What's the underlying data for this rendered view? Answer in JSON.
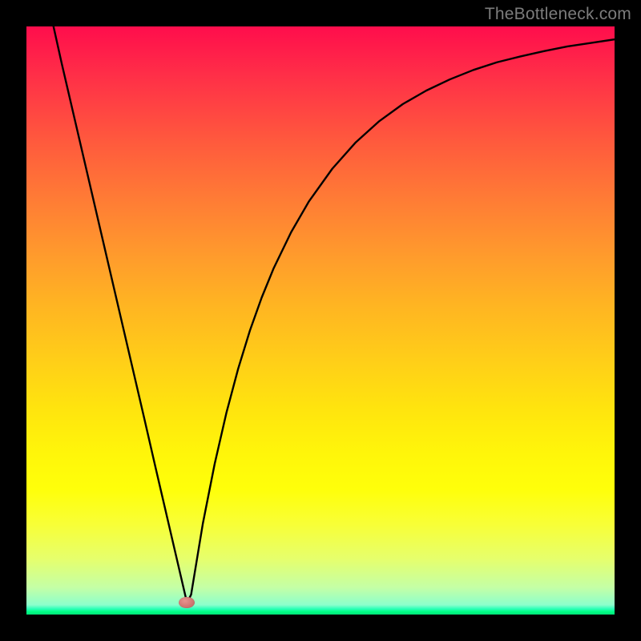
{
  "watermark": "TheBottleneck.com",
  "colors": {
    "frame": "#000000",
    "curve_stroke": "#000000",
    "marker_fill": "#d67c78",
    "gradient_top": "#ff0d4c",
    "gradient_mid": "#ffe40e",
    "gradient_bottom_green": "#03e27a"
  },
  "chart_data": {
    "type": "line",
    "title": "",
    "xlabel": "",
    "ylabel": "",
    "xlim": [
      0,
      100
    ],
    "ylim": [
      0,
      100
    ],
    "series": [
      {
        "name": "bottleneck-curve",
        "x": [
          4.6,
          6,
          8,
          10,
          12,
          14,
          16,
          18,
          20,
          22,
          24,
          26,
          27.3,
          28,
          30,
          32,
          34,
          36,
          38,
          40,
          42,
          45,
          48,
          52,
          56,
          60,
          64,
          68,
          72,
          76,
          80,
          84,
          88,
          92,
          96,
          100
        ],
        "y": [
          100,
          93.7,
          85.1,
          76.5,
          67.9,
          59.3,
          50.7,
          42.1,
          33.5,
          24.8,
          16.2,
          7.6,
          2.0,
          3.4,
          15.5,
          25.6,
          34.3,
          41.8,
          48.3,
          53.9,
          58.8,
          65.0,
          70.2,
          75.8,
          80.3,
          83.9,
          86.8,
          89.1,
          91.0,
          92.6,
          93.9,
          94.9,
          95.8,
          96.6,
          97.2,
          97.8
        ]
      }
    ],
    "marker": {
      "x": 27.3,
      "y": 2.0
    },
    "background": {
      "type": "vertical-gradient",
      "stops": [
        {
          "pos": 0.0,
          "color": "#ff0d4c"
        },
        {
          "pos": 0.5,
          "color": "#ffb422"
        },
        {
          "pos": 0.8,
          "color": "#ffff0a"
        },
        {
          "pos": 0.99,
          "color": "#03e27a"
        }
      ]
    }
  }
}
